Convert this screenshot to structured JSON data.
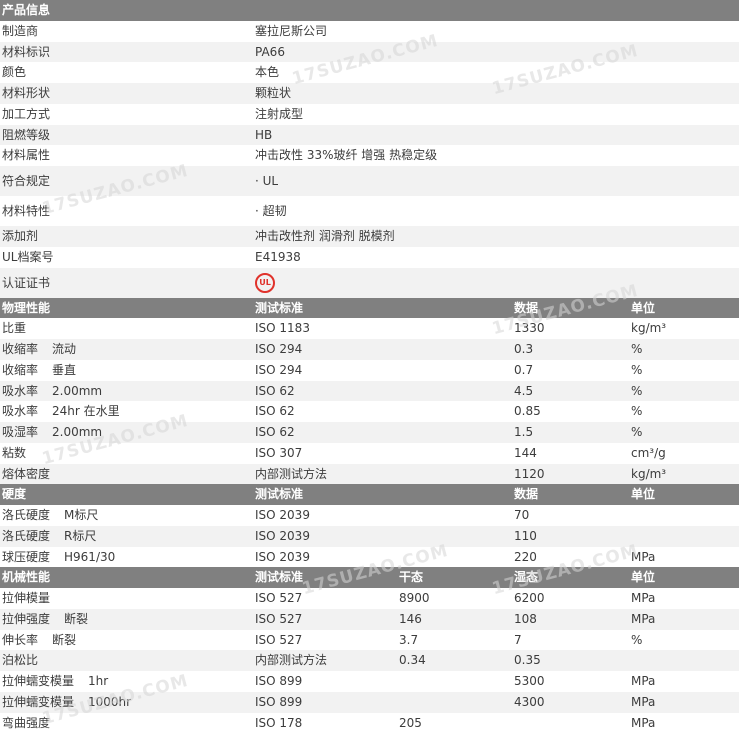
{
  "watermark": "17SUZAO.COM",
  "product_info": {
    "header": "产品信息",
    "rows": [
      {
        "label": "制造商",
        "value": "塞拉尼斯公司"
      },
      {
        "label": "材料标识",
        "value": "PA66"
      },
      {
        "label": "颜色",
        "value": "本色"
      },
      {
        "label": "材料形状",
        "value": "颗粒状"
      },
      {
        "label": "加工方式",
        "value": "注射成型"
      },
      {
        "label": "阻燃等级",
        "value": "HB"
      },
      {
        "label": "材料属性",
        "value": "冲击改性 33%玻纤 增强 热稳定级"
      },
      {
        "label": "符合规定",
        "value": "· UL"
      },
      {
        "label": "材料特性",
        "value": "· 超韧"
      },
      {
        "label": "添加剂",
        "value": "冲击改性剂 润滑剂 脱模剂"
      },
      {
        "label": "UL档案号",
        "value": "E41938"
      },
      {
        "label": "认证证书",
        "value": "",
        "badge": "UL"
      }
    ]
  },
  "physical": {
    "header": {
      "c1": "物理性能",
      "c2": "测试标准",
      "c4": "数据",
      "c5": "单位"
    },
    "rows": [
      {
        "name": "比重",
        "cond": "",
        "std": "ISO 1183",
        "data": "1330",
        "unit": "kg/m³"
      },
      {
        "name": "收缩率",
        "cond": "流动",
        "std": "ISO 294",
        "data": "0.3",
        "unit": "%"
      },
      {
        "name": "收缩率",
        "cond": "垂直",
        "std": "ISO 294",
        "data": "0.7",
        "unit": "%"
      },
      {
        "name": "吸水率",
        "cond": "2.00mm",
        "std": "ISO 62",
        "data": "4.5",
        "unit": "%"
      },
      {
        "name": "吸水率",
        "cond": "24hr 在水里",
        "std": "ISO 62",
        "data": "0.85",
        "unit": "%"
      },
      {
        "name": "吸湿率",
        "cond": "2.00mm",
        "std": "ISO 62",
        "data": "1.5",
        "unit": "%"
      },
      {
        "name": "粘数",
        "cond": "",
        "std": "ISO 307",
        "data": "144",
        "unit": "cm³/g"
      },
      {
        "name": "熔体密度",
        "cond": "",
        "std": "内部测试方法",
        "data": "1120",
        "unit": "kg/m³"
      }
    ]
  },
  "hardness": {
    "header": {
      "c1": "硬度",
      "c2": "测试标准",
      "c4": "数据",
      "c5": "单位"
    },
    "rows": [
      {
        "name": "洛氏硬度",
        "cond": "M标尺",
        "std": "ISO 2039",
        "data": "70",
        "unit": ""
      },
      {
        "name": "洛氏硬度",
        "cond": "R标尺",
        "std": "ISO 2039",
        "data": "110",
        "unit": ""
      },
      {
        "name": "球压硬度",
        "cond": "H961/30",
        "std": "ISO 2039",
        "data": "220",
        "unit": "MPa"
      }
    ]
  },
  "mechanical": {
    "header": {
      "c1": "机械性能",
      "c2": "测试标准",
      "c3": "干态",
      "c4": "湿态",
      "c5": "单位"
    },
    "rows": [
      {
        "name": "拉伸模量",
        "cond": "",
        "std": "ISO 527",
        "dry": "8900",
        "wet": "6200",
        "unit": "MPa"
      },
      {
        "name": "拉伸强度",
        "cond": "断裂",
        "std": "ISO 527",
        "dry": "146",
        "wet": "108",
        "unit": "MPa"
      },
      {
        "name": "伸长率",
        "cond": "断裂",
        "std": "ISO 527",
        "dry": "3.7",
        "wet": "7",
        "unit": "%"
      },
      {
        "name": "泊松比",
        "cond": "",
        "std": "内部测试方法",
        "dry": "0.34",
        "wet": "0.35",
        "unit": ""
      },
      {
        "name": "拉伸蠕变模量",
        "cond": "1hr",
        "std": "ISO 899",
        "dry": "",
        "wet": "5300",
        "unit": "MPa"
      },
      {
        "name": "拉伸蠕变模量",
        "cond": "1000hr",
        "std": "ISO 899",
        "dry": "",
        "wet": "4300",
        "unit": "MPa"
      },
      {
        "name": "弯曲强度",
        "cond": "",
        "std": "ISO 178",
        "dry": "205",
        "wet": "",
        "unit": "MPa"
      }
    ]
  }
}
